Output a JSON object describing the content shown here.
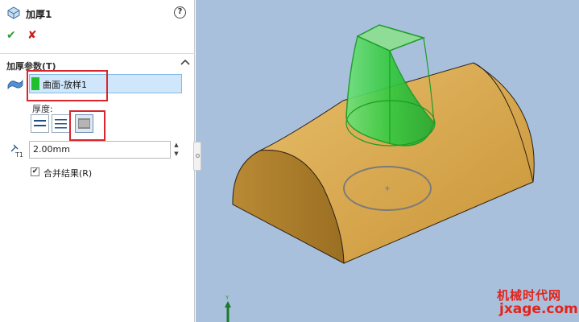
{
  "feature": {
    "title": "加厚1"
  },
  "group": {
    "title": "加厚参数(T)",
    "selection": "曲面-放样1",
    "thickness_label": "厚度:",
    "depth_value": "2.00mm",
    "merge_label": "合并结果(R)",
    "merge_checked": true
  },
  "help": {
    "glyph": "?"
  },
  "actions": {
    "ok": "✔",
    "cancel": "✘"
  },
  "watermark": {
    "line1": "机械时代网",
    "line2": "jxage.com"
  },
  "triad": {
    "y_label": "Y"
  },
  "colors": {
    "accent_red": "#d9262c",
    "selection_green": "#1fbf2e",
    "model_gold": "#d3a24f",
    "viewport_bg": "#a9c0dd"
  }
}
